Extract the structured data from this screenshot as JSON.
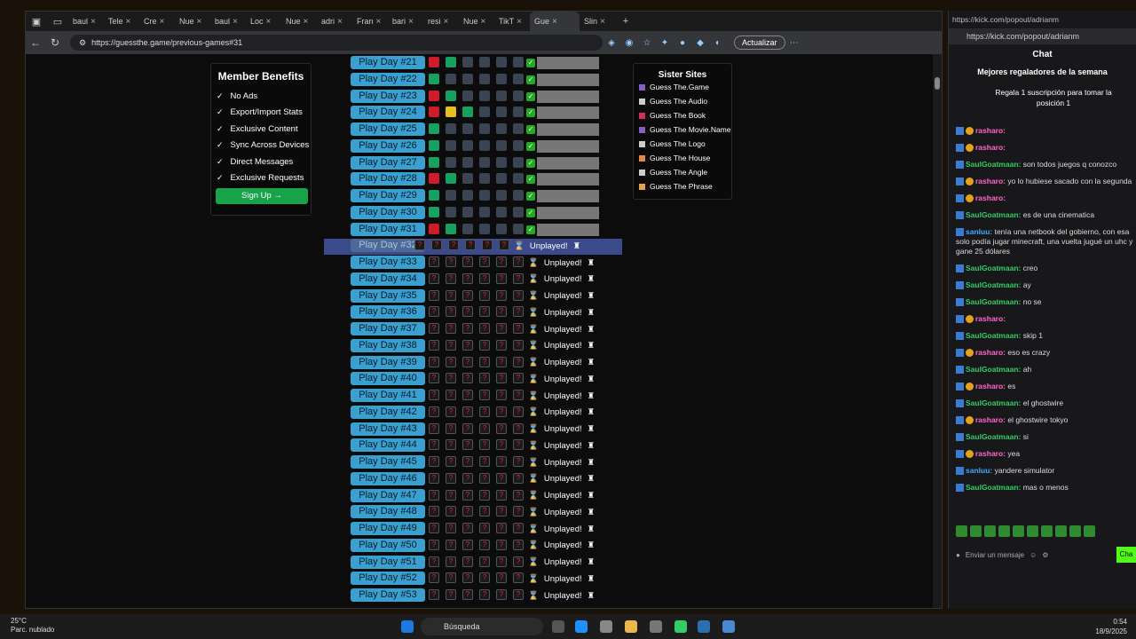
{
  "browser": {
    "url": "https://guessthe.game/previous-games#31",
    "update_label": "Actualizar",
    "tabs": [
      "baul",
      "Tele",
      "Cre",
      "Nue",
      "baul",
      "Loc",
      "Nue",
      "adri",
      "Fran",
      "bari",
      "resi",
      "Nue",
      "TikT",
      "Gue",
      "Slin"
    ]
  },
  "member": {
    "title": "Member Benefits",
    "items": [
      "No Ads",
      "Export/Import Stats",
      "Exclusive Content",
      "Sync Across Devices",
      "Direct Messages",
      "Exclusive Requests"
    ],
    "signup": "Sign Up →"
  },
  "sister": {
    "title": "Sister Sites",
    "items": [
      {
        "label": "Guess The.Game",
        "color": "#8a5cc6"
      },
      {
        "label": "Guess The Audio",
        "color": "#cccccc"
      },
      {
        "label": "Guess The Book",
        "color": "#d22f5a"
      },
      {
        "label": "Guess The Movie.Name",
        "color": "#8a5cc6"
      },
      {
        "label": "Guess The Logo",
        "color": "#cccccc"
      },
      {
        "label": "Guess The House",
        "color": "#e08a4a"
      },
      {
        "label": "Guess The Angle",
        "color": "#cccccc"
      },
      {
        "label": "Guess The Phrase",
        "color": "#e0a34a"
      }
    ]
  },
  "played": [
    {
      "label": "Play Day #21",
      "cells": [
        "r",
        "g",
        "n",
        "n",
        "n",
        "n"
      ]
    },
    {
      "label": "Play Day #22",
      "cells": [
        "g",
        "n",
        "n",
        "n",
        "n",
        "n"
      ]
    },
    {
      "label": "Play Day #23",
      "cells": [
        "r",
        "g",
        "n",
        "n",
        "n",
        "n"
      ]
    },
    {
      "label": "Play Day #24",
      "cells": [
        "r",
        "y",
        "g",
        "n",
        "n",
        "n"
      ]
    },
    {
      "label": "Play Day #25",
      "cells": [
        "g",
        "n",
        "n",
        "n",
        "n",
        "n"
      ]
    },
    {
      "label": "Play Day #26",
      "cells": [
        "g",
        "n",
        "n",
        "n",
        "n",
        "n"
      ]
    },
    {
      "label": "Play Day #27",
      "cells": [
        "g",
        "n",
        "n",
        "n",
        "n",
        "n"
      ]
    },
    {
      "label": "Play Day #28",
      "cells": [
        "r",
        "g",
        "n",
        "n",
        "n",
        "n"
      ]
    },
    {
      "label": "Play Day #29",
      "cells": [
        "g",
        "n",
        "n",
        "n",
        "n",
        "n"
      ]
    },
    {
      "label": "Play Day #30",
      "cells": [
        "g",
        "n",
        "n",
        "n",
        "n",
        "n"
      ]
    },
    {
      "label": "Play Day #31",
      "cells": [
        "r",
        "g",
        "n",
        "n",
        "n",
        "n"
      ]
    }
  ],
  "unplayed": [
    "Play Day #32",
    "Play Day #33",
    "Play Day #34",
    "Play Day #35",
    "Play Day #36",
    "Play Day #37",
    "Play Day #38",
    "Play Day #39",
    "Play Day #40",
    "Play Day #41",
    "Play Day #42",
    "Play Day #43",
    "Play Day #44",
    "Play Day #45",
    "Play Day #46",
    "Play Day #47",
    "Play Day #48",
    "Play Day #49",
    "Play Day #50",
    "Play Day #51",
    "Play Day #52",
    "Play Day #53"
  ],
  "unplayed_label": "Unplayed!",
  "q_mark": "?",
  "chat": {
    "url": "https://kick.com/popout/adrianm",
    "title": "Chat",
    "gifters": "Mejores regaladores de la semana",
    "gift_msg": "Regala 1 suscripción para tomar la posición 1",
    "input_placeholder": "Enviar un mensaje",
    "send": "Cha",
    "messages": [
      {
        "user": "rasharo:",
        "text": "",
        "c": "r"
      },
      {
        "user": "rasharo:",
        "text": "",
        "c": "r"
      },
      {
        "user": "SaulGoatmaan:",
        "text": "son todos juegos q conozco",
        "c": "g"
      },
      {
        "user": "rasharo:",
        "text": "yo lo hubiese sacado con la segunda",
        "c": "r"
      },
      {
        "user": "rasharo:",
        "text": "",
        "c": "r"
      },
      {
        "user": "SaulGoatmaan:",
        "text": "es de una cinematica",
        "c": "g"
      },
      {
        "user": "sanluu:",
        "text": "tenía una netbook del gobierno, con esa solo podía jugar minecraft, una vuelta jugué un uhc y gane 25 dólares",
        "c": "b"
      },
      {
        "user": "SaulGoatmaan:",
        "text": "creo",
        "c": "g"
      },
      {
        "user": "SaulGoatmaan:",
        "text": "ay",
        "c": "g"
      },
      {
        "user": "SaulGoatmaan:",
        "text": "no se",
        "c": "g"
      },
      {
        "user": "rasharo:",
        "text": "",
        "c": "r"
      },
      {
        "user": "SaulGoatmaan:",
        "text": "skip 1",
        "c": "g"
      },
      {
        "user": "rasharo:",
        "text": "eso es crazy",
        "c": "r"
      },
      {
        "user": "SaulGoatmaan:",
        "text": "ah",
        "c": "g"
      },
      {
        "user": "rasharo:",
        "text": "es",
        "c": "r"
      },
      {
        "user": "SaulGoatmaan:",
        "text": "el ghostwire",
        "c": "g"
      },
      {
        "user": "rasharo:",
        "text": "el ghostwire tokyo",
        "c": "r"
      },
      {
        "user": "SaulGoatmaan:",
        "text": "si",
        "c": "g"
      },
      {
        "user": "rasharo:",
        "text": "yea",
        "c": "r"
      },
      {
        "user": "sanluu:",
        "text": "yandere simulator",
        "c": "b"
      },
      {
        "user": "SaulGoatmaan:",
        "text": "mas o menos",
        "c": "g"
      }
    ]
  },
  "taskbar": {
    "search": "Búsqueda",
    "temp": "25°C",
    "weather": "Parc. nublado",
    "time": "0:54",
    "date": "18/9/2025"
  }
}
